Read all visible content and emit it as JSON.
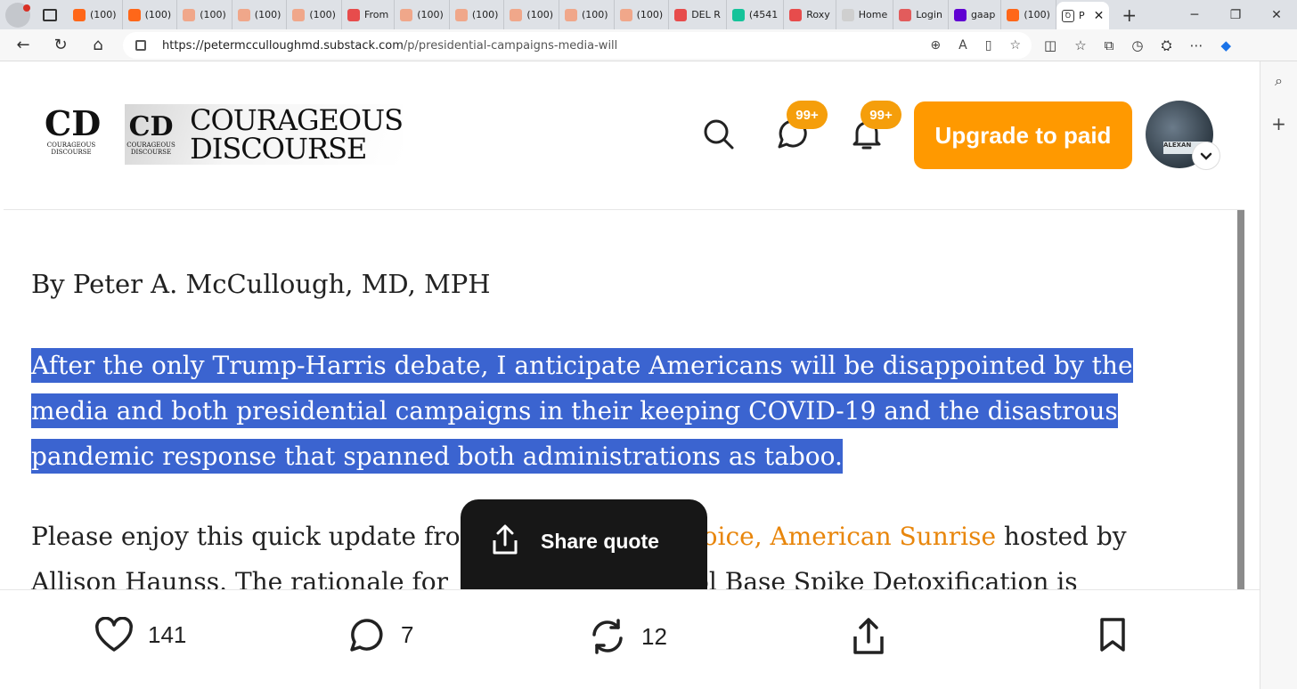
{
  "browser": {
    "tabs": [
      {
        "label": "(100)",
        "icon": "substack-icon",
        "color": "#ff6719"
      },
      {
        "label": "(100)",
        "icon": "substack-icon",
        "color": "#ff6719"
      },
      {
        "label": "(100)",
        "icon": "substack-icon",
        "color": "#f0a78a"
      },
      {
        "label": "(100)",
        "icon": "substack-icon",
        "color": "#f0a78a"
      },
      {
        "label": "(100)",
        "icon": "substack-icon",
        "color": "#f0a78a"
      },
      {
        "label": "From",
        "icon": "youtube-icon",
        "color": "#e74c4c"
      },
      {
        "label": "(100)",
        "icon": "substack-icon",
        "color": "#f0a78a"
      },
      {
        "label": "(100)",
        "icon": "substack-icon",
        "color": "#f0a78a"
      },
      {
        "label": "(100)",
        "icon": "substack-icon",
        "color": "#f0a78a"
      },
      {
        "label": "(100)",
        "icon": "substack-icon",
        "color": "#f0a78a"
      },
      {
        "label": "(100)",
        "icon": "substack-icon",
        "color": "#f0a78a"
      },
      {
        "label": "DEL R",
        "icon": "youtube-icon",
        "color": "#e74c4c"
      },
      {
        "label": "(4541",
        "icon": "grammarly-icon",
        "color": "#15c39a"
      },
      {
        "label": "Roxy",
        "icon": "youtube-icon",
        "color": "#e74c4c"
      },
      {
        "label": "Home",
        "icon": "page-icon",
        "color": "#cfcfcf"
      },
      {
        "label": "Login",
        "icon": "login-icon",
        "color": "#e25c5c"
      },
      {
        "label": "gaap",
        "icon": "yahoo-icon",
        "color": "#6001d2"
      },
      {
        "label": "(100)",
        "icon": "substack-icon",
        "color": "#ff6719"
      }
    ],
    "active_tab": {
      "label": "P",
      "icon": "courageous-discourse-icon",
      "close": "✕"
    },
    "new_tab": "+",
    "url_host": "https://petermcculloughmd.substack.com",
    "url_path": "/p/presidential-campaigns-media-will"
  },
  "header": {
    "logo_mark": "CD",
    "logo_sub": "COURAGEOUS DISCOURSE",
    "wordmark_line1": "COURAGEOUS",
    "wordmark_line2": "DISCOURSE",
    "chat_badge": "99+",
    "notif_badge": "99+",
    "upgrade_label": "Upgrade to paid",
    "avatar_sign": "ALEXAN"
  },
  "article": {
    "byline": "By Peter A. McCullough, MD, MPH",
    "selected_lines": [
      "After the only Trump-Harris debate, I anticipate Americans will be disappointed by the",
      "media and both presidential campaigns in their keeping COVID-19 and the disastrous",
      "pandemic response that spanned both administrations as taboo."
    ],
    "para2_before": "Please enjoy this quick update fro",
    "para2_link": "oice, American Sunrise",
    "para2_after": " hosted by",
    "para2_line2_a": "Allison Haunss. The rationale for",
    "para2_line2_b": "ol Base Spike Detoxification is"
  },
  "share_popover": {
    "label": "Share quote"
  },
  "actions": {
    "likes": "141",
    "comments": "7",
    "restacks": "12"
  },
  "colors": {
    "accent": "#ff9900",
    "selection": "#3b64d0",
    "link": "#e8860c",
    "popover": "#171717"
  }
}
